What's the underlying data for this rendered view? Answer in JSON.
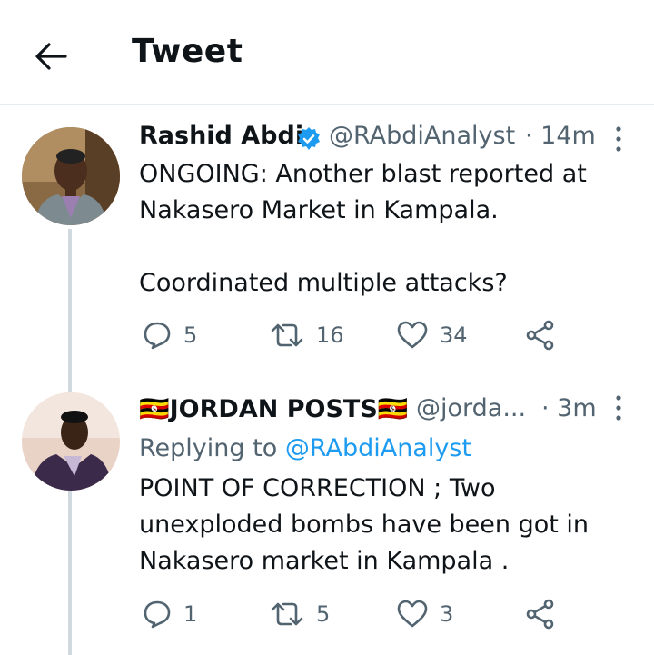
{
  "header": {
    "title": "Tweet"
  },
  "tweets": [
    {
      "name": "Rashid Abdi",
      "verified": true,
      "handle": "@RAbdiAnalyst",
      "time": "· 14m",
      "text_line1": "ONGOING: Another blast reported at",
      "text_line2": "Nakasero Market in Kampala.",
      "text_line3": "Coordinated multiple attacks?",
      "replies": "5",
      "retweets": "16",
      "likes": "34"
    },
    {
      "name": "JORDAN POSTS",
      "name_flags": "🇺🇬",
      "handle": "@jorda...",
      "time": "· 3m",
      "replying_prefix": "Replying to",
      "replying_to": "@RAbdiAnalyst",
      "text_line1": "POINT OF CORRECTION ; Two",
      "text_line2": "unexploded bombs have been got in",
      "text_line3": "Nakasero market in Kampala .",
      "replies": "1",
      "retweets": "5",
      "likes": "3"
    }
  ],
  "icons": {
    "back": "arrow-left-icon",
    "verified": "verified-badge-icon",
    "more": "more-vertical-icon",
    "reply": "reply-icon",
    "retweet": "retweet-icon",
    "like": "heart-icon",
    "share": "share-icon"
  },
  "colors": {
    "accent": "#1d9bf0",
    "muted": "#536471",
    "text": "#0f1419"
  }
}
